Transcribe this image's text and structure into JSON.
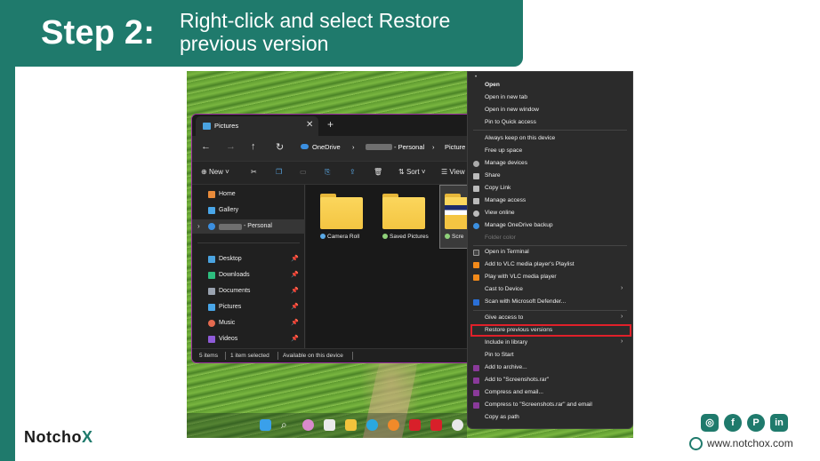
{
  "header": {
    "step": "Step 2:",
    "instruction": "Right-click and select Restore previous version"
  },
  "explorer": {
    "tab_title": "Pictures",
    "tab_close": "✕",
    "tab_add": "+",
    "breadcrumb": [
      "OneDrive",
      "- Personal",
      "Picture"
    ],
    "breadcrumb_sep": "›",
    "toolbar": {
      "new": "New",
      "sort": "Sort",
      "view": "View"
    },
    "nav": {
      "home": "Home",
      "gallery": "Gallery",
      "onedrive_personal": "- Personal",
      "desktop": "Desktop",
      "downloads": "Downloads",
      "documents": "Documents",
      "pictures": "Pictures",
      "music": "Music",
      "videos": "Videos"
    },
    "folders": {
      "camera_roll": "Camera Roll",
      "saved_pictures": "Saved Pictures",
      "screenshots_partial": "Scre"
    },
    "status": {
      "items": "5 items",
      "selected": "1 item selected",
      "availability": "Available on this device"
    }
  },
  "context_menu": {
    "open": "Open",
    "open_new_tab": "Open in new tab",
    "open_new_window": "Open in new window",
    "pin_quick_access": "Pin to Quick access",
    "always_keep": "Always keep on this device",
    "free_up_space": "Free up space",
    "manage_devices": "Manage devices",
    "share": "Share",
    "copy_link": "Copy Link",
    "manage_access": "Manage access",
    "view_online": "View online",
    "manage_backup": "Manage OneDrive backup",
    "folder_color": "Folder color",
    "open_terminal": "Open in Terminal",
    "add_vlc_playlist": "Add to VLC media player's Playlist",
    "play_vlc": "Play with VLC media player",
    "cast_to_device": "Cast to Device",
    "scan_defender": "Scan with Microsoft Defender...",
    "give_access": "Give access to",
    "restore_previous": "Restore previous versions",
    "include_library": "Include in library",
    "pin_start": "Pin to Start",
    "add_archive": "Add to archive...",
    "add_rar": "Add to \"Screenshots.rar\"",
    "compress_email": "Compress and email...",
    "compress_rar_email": "Compress to \"Screenshots.rar\" and email",
    "copy_as_path": "Copy as path"
  },
  "footer": {
    "logo_prefix": "Notch",
    "logo_o": "o",
    "logo_x": "X",
    "website": "www.notchox.com",
    "social": {
      "instagram": "◎",
      "facebook": "f",
      "pinterest": "P",
      "linkedin": "in"
    }
  },
  "colors": {
    "brand": "#1f7a6c",
    "highlight": "#e0202a",
    "window_border": "#9c2fa0"
  }
}
